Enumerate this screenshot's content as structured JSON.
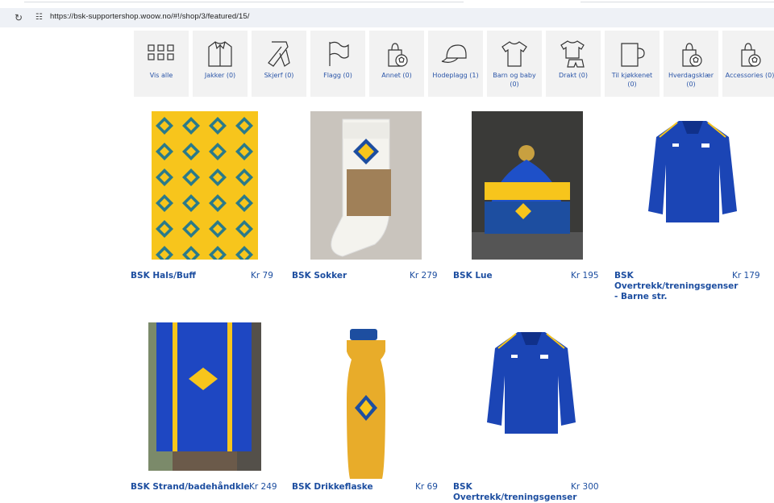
{
  "browser": {
    "url": "https://bsk-supportershop.woow.no/#!/shop/3/featured/15/"
  },
  "categories": [
    {
      "label": "Vis alle",
      "icon": "grid-icon"
    },
    {
      "label": "Jakker (0)",
      "icon": "jacket-icon"
    },
    {
      "label": "Skjerf (0)",
      "icon": "scarf-icon"
    },
    {
      "label": "Flagg (0)",
      "icon": "flag-icon"
    },
    {
      "label": "Annet (0)",
      "icon": "bag-ball-icon"
    },
    {
      "label": "Hodeplagg (1)",
      "icon": "cap-icon"
    },
    {
      "label": "Barn og baby (0)",
      "icon": "tshirt-icon"
    },
    {
      "label": "Drakt (0)",
      "icon": "kit-icon"
    },
    {
      "label": "Til kjøkkenet (0)",
      "icon": "mug-icon"
    },
    {
      "label": "Hverdagsklær (0)",
      "icon": "bag-ball-icon"
    },
    {
      "label": "Accessories (0)",
      "icon": "bag-ball-icon"
    }
  ],
  "products": [
    {
      "name": "BSK Hals/Buff",
      "price": "Kr 79"
    },
    {
      "name": "BSK Sokker",
      "price": "Kr 279"
    },
    {
      "name": "BSK Lue",
      "price": "Kr 195"
    },
    {
      "name": "BSK Overtrekk/treningsgenser - Barne str.",
      "price": "Kr 179"
    },
    {
      "name": "BSK Strand/badehåndkle",
      "price": "Kr 249"
    },
    {
      "name": "BSK Drikkeflaske",
      "price": "Kr 69"
    },
    {
      "name": "BSK Overtrekk/treningsgenser",
      "price": "Kr 300"
    }
  ],
  "colors": {
    "brand_blue": "#1d4ea0",
    "brand_yellow": "#f7c51c",
    "category_bg": "#f2f2f2"
  }
}
